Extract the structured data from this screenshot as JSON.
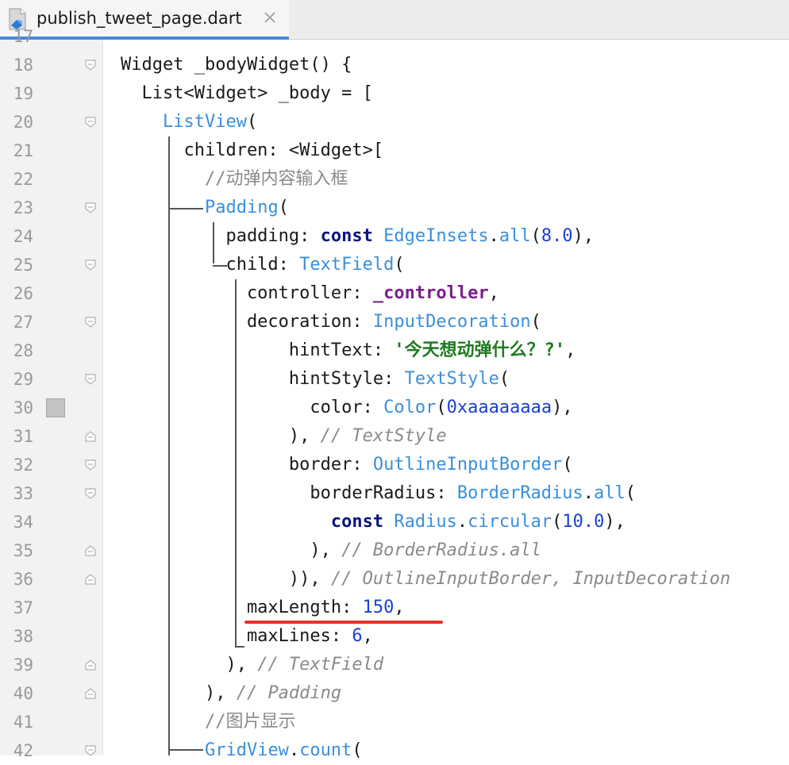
{
  "tab": {
    "title": "publish_tweet_page.dart"
  },
  "editor": {
    "top_partial_line": "17",
    "lines": [
      {
        "n": "18",
        "fold": "open",
        "t": [
          [
            "p",
            "Widget _bodyWidget() {"
          ]
        ]
      },
      {
        "n": "19",
        "fold": "",
        "t": [
          [
            "p",
            "  List<Widget> _body = ["
          ]
        ]
      },
      {
        "n": "20",
        "fold": "open",
        "t": [
          [
            "p",
            "    "
          ],
          [
            "cls",
            "ListView"
          ],
          [
            "p",
            "("
          ]
        ]
      },
      {
        "n": "21",
        "fold": "",
        "t": [
          [
            "p",
            "      children: <Widget>["
          ]
        ]
      },
      {
        "n": "22",
        "fold": "",
        "t": [
          [
            "p",
            "        "
          ],
          [
            "cmtn",
            "//动弹内容输入框"
          ]
        ]
      },
      {
        "n": "23",
        "fold": "open",
        "t": [
          [
            "p",
            "        "
          ],
          [
            "cls",
            "Padding"
          ],
          [
            "p",
            "("
          ]
        ]
      },
      {
        "n": "24",
        "fold": "",
        "t": [
          [
            "p",
            "          padding: "
          ],
          [
            "kw",
            "const "
          ],
          [
            "cls",
            "EdgeInsets"
          ],
          [
            "p",
            "."
          ],
          [
            "cls",
            "all"
          ],
          [
            "p",
            "("
          ],
          [
            "num",
            "8.0"
          ],
          [
            "p",
            "),"
          ]
        ]
      },
      {
        "n": "25",
        "fold": "open",
        "t": [
          [
            "p",
            "          child: "
          ],
          [
            "cls",
            "TextField"
          ],
          [
            "p",
            "("
          ]
        ]
      },
      {
        "n": "26",
        "fold": "",
        "t": [
          [
            "p",
            "            controller: "
          ],
          [
            "fld",
            "_controller"
          ],
          [
            "p",
            ","
          ]
        ]
      },
      {
        "n": "27",
        "fold": "open",
        "t": [
          [
            "p",
            "            decoration: "
          ],
          [
            "cls",
            "InputDecoration"
          ],
          [
            "p",
            "("
          ]
        ]
      },
      {
        "n": "28",
        "fold": "",
        "t": [
          [
            "p",
            "                hintText: "
          ],
          [
            "str",
            "'今天想动弹什么？?'"
          ],
          [
            "p",
            ","
          ]
        ]
      },
      {
        "n": "29",
        "fold": "open",
        "t": [
          [
            "p",
            "                hintStyle: "
          ],
          [
            "cls",
            "TextStyle"
          ],
          [
            "p",
            "("
          ]
        ]
      },
      {
        "n": "30",
        "fold": "",
        "t": [
          [
            "p",
            "                  color: "
          ],
          [
            "cls",
            "Color"
          ],
          [
            "p",
            "("
          ],
          [
            "num",
            "0xaaaaaaaa"
          ],
          [
            "p",
            "),"
          ]
        ]
      },
      {
        "n": "31",
        "fold": "close",
        "t": [
          [
            "p",
            "                ), "
          ],
          [
            "cmt",
            "// TextStyle"
          ]
        ]
      },
      {
        "n": "32",
        "fold": "open",
        "t": [
          [
            "p",
            "                border: "
          ],
          [
            "cls",
            "OutlineInputBorder"
          ],
          [
            "p",
            "("
          ]
        ]
      },
      {
        "n": "33",
        "fold": "open",
        "t": [
          [
            "p",
            "                  borderRadius: "
          ],
          [
            "cls",
            "BorderRadius"
          ],
          [
            "p",
            "."
          ],
          [
            "cls",
            "all"
          ],
          [
            "p",
            "("
          ]
        ]
      },
      {
        "n": "34",
        "fold": "",
        "t": [
          [
            "p",
            "                    "
          ],
          [
            "kw",
            "const "
          ],
          [
            "cls",
            "Radius"
          ],
          [
            "p",
            "."
          ],
          [
            "cls",
            "circular"
          ],
          [
            "p",
            "("
          ],
          [
            "num",
            "10.0"
          ],
          [
            "p",
            "),"
          ]
        ]
      },
      {
        "n": "35",
        "fold": "close",
        "t": [
          [
            "p",
            "                  ), "
          ],
          [
            "cmt",
            "// BorderRadius.all"
          ]
        ]
      },
      {
        "n": "36",
        "fold": "close",
        "t": [
          [
            "p",
            "                )), "
          ],
          [
            "cmt",
            "// OutlineInputBorder, InputDecoration"
          ]
        ]
      },
      {
        "n": "37",
        "fold": "",
        "t": [
          [
            "p",
            "            maxLength: "
          ],
          [
            "num",
            "150"
          ],
          [
            "p",
            ","
          ]
        ]
      },
      {
        "n": "38",
        "fold": "",
        "t": [
          [
            "p",
            "            maxLines: "
          ],
          [
            "num",
            "6"
          ],
          [
            "p",
            ","
          ]
        ]
      },
      {
        "n": "39",
        "fold": "close",
        "t": [
          [
            "p",
            "          ), "
          ],
          [
            "cmt",
            "// TextField"
          ]
        ]
      },
      {
        "n": "40",
        "fold": "close",
        "t": [
          [
            "p",
            "        ), "
          ],
          [
            "cmt",
            "// Padding"
          ]
        ]
      },
      {
        "n": "41",
        "fold": "",
        "t": [
          [
            "p",
            "        "
          ],
          [
            "cmtn",
            "//图片显示"
          ]
        ]
      },
      {
        "n": "42",
        "fold": "open",
        "t": [
          [
            "p",
            "        "
          ],
          [
            "cls",
            "GridView"
          ],
          [
            "p",
            "."
          ],
          [
            "cls",
            "count"
          ],
          [
            "p",
            "("
          ]
        ]
      }
    ]
  },
  "colors": {
    "keyword": "#0a1480",
    "class": "#3a8fdc",
    "number": "#1a3fd6",
    "string": "#1f7a1f",
    "field": "#7a1f8a",
    "comment": "#8a8a8a",
    "highlight_underline": "#e8302a",
    "tab_accent": "#4a88d9"
  },
  "icons": {
    "file": "dart-file-icon",
    "close": "close-icon",
    "fold": "fold-marker-icon",
    "breakpoint": "bookmark-marker-icon"
  }
}
